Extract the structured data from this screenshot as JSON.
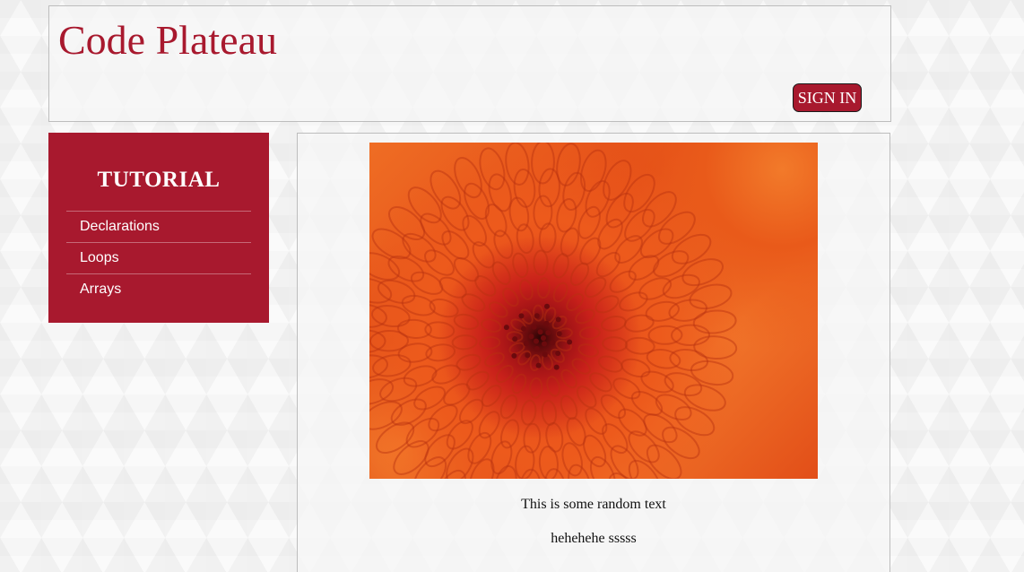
{
  "header": {
    "site_title": "Code Plateau",
    "signin_label": "SIGN IN"
  },
  "sidebar": {
    "title": "TUTORIAL",
    "items": [
      {
        "label": "Declarations"
      },
      {
        "label": "Loops"
      },
      {
        "label": "Arrays"
      }
    ]
  },
  "main": {
    "image_subject": "orange-chrysanthemum-flower",
    "paragraphs": [
      "This is some random text",
      "hehehehe sssss"
    ]
  },
  "colors": {
    "brand": "#a8192e",
    "text": "#111111",
    "background": "#f6f6f6"
  }
}
